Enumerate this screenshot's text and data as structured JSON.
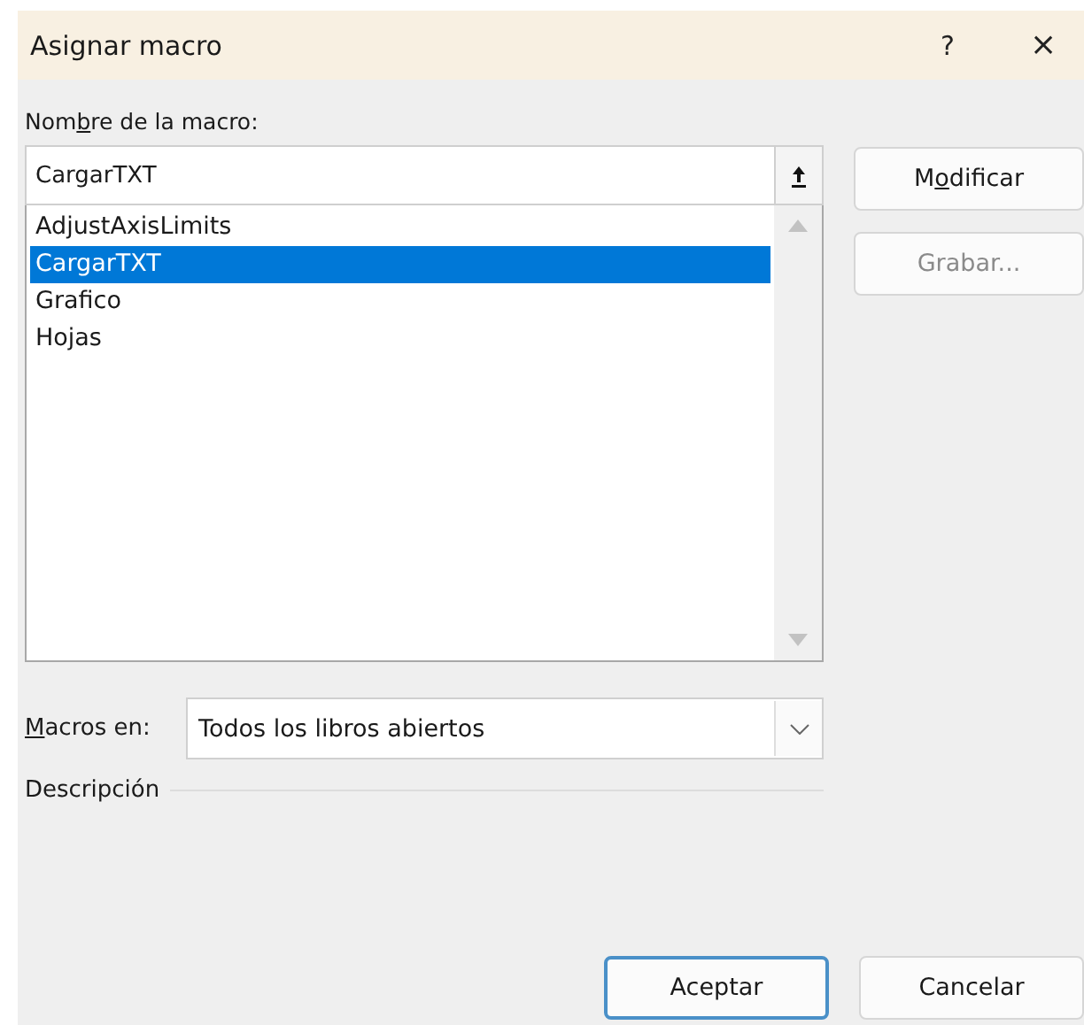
{
  "window": {
    "title": "Asignar macro",
    "help": "?",
    "close": "×"
  },
  "name_label": {
    "parts": [
      {
        "text": "Nom",
        "underlined": false
      },
      {
        "text": "b",
        "underlined": true
      },
      {
        "text": "re de la macro:",
        "underlined": false
      }
    ]
  },
  "name_field": {
    "value": "CargarTXT"
  },
  "macros": [
    {
      "name": "AdjustAxisLimits",
      "selected": false
    },
    {
      "name": "CargarTXT",
      "selected": true
    },
    {
      "name": "Grafico",
      "selected": false
    },
    {
      "name": "Hojas",
      "selected": false
    }
  ],
  "side_buttons": [
    {
      "parts": [
        {
          "text": "M",
          "underlined": false
        },
        {
          "text": "o",
          "underlined": true
        },
        {
          "text": "dificar",
          "underlined": false
        }
      ],
      "disabled": false
    },
    {
      "parts": [
        {
          "text": "Grabar...",
          "underlined": false
        }
      ],
      "disabled": true
    }
  ],
  "macros_in": {
    "parts": [
      {
        "text": "M",
        "underlined": true
      },
      {
        "text": "acros en:",
        "underlined": false
      }
    ],
    "value": "Todos los libros abiertos"
  },
  "description": {
    "label": "Descripción"
  },
  "buttons": [
    {
      "label": "Aceptar",
      "default": true
    },
    {
      "label": "Cancelar",
      "default": false
    }
  ]
}
